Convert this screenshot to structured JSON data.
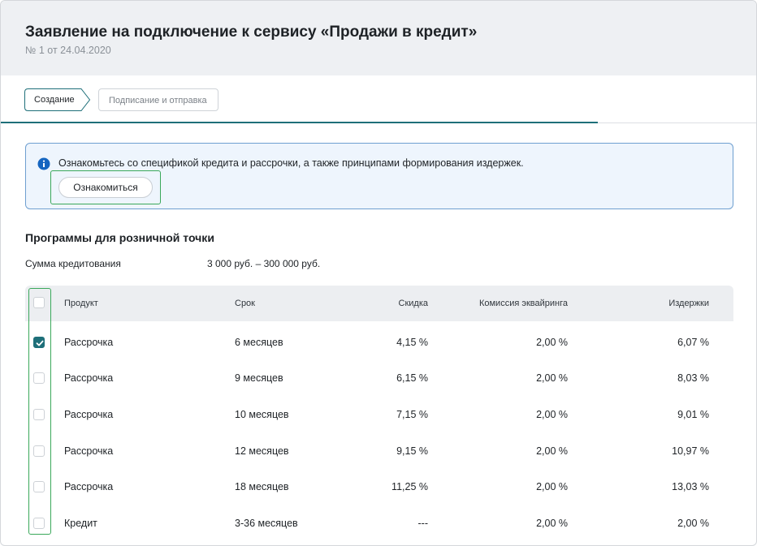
{
  "header": {
    "title": "Заявление на подключение к сервису «Продажи в кредит»",
    "subtitle": "№ 1 от 24.04.2020"
  },
  "steps": [
    {
      "label": "Создание",
      "active": true
    },
    {
      "label": "Подписание и отправка",
      "active": false
    }
  ],
  "progress": {
    "fraction": 0.79
  },
  "notice": {
    "text": "Ознакомьтесь со спецификой кредита и рассрочки, а также принципами формирования издержек.",
    "button_label": "Ознакомиться",
    "icon": "info-icon"
  },
  "programs": {
    "title": "Программы для розничной точки",
    "sum_label": "Сумма кредитования",
    "sum_value": "3 000 руб. – 300 000 руб."
  },
  "table": {
    "headers": {
      "product": "Продукт",
      "term": "Срок",
      "discount": "Скидка",
      "acquiring": "Комиссия эквайринга",
      "costs": "Издержки"
    },
    "rows": [
      {
        "checked": true,
        "product": "Рассрочка",
        "term": "6 месяцев",
        "discount": "4,15 %",
        "acquiring": "2,00 %",
        "costs": "6,07 %"
      },
      {
        "checked": false,
        "product": "Рассрочка",
        "term": "9 месяцев",
        "discount": "6,15 %",
        "acquiring": "2,00 %",
        "costs": "8,03 %"
      },
      {
        "checked": false,
        "product": "Рассрочка",
        "term": "10 месяцев",
        "discount": "7,15 %",
        "acquiring": "2,00 %",
        "costs": "9,01 %"
      },
      {
        "checked": false,
        "product": "Рассрочка",
        "term": "12 месяцев",
        "discount": "9,15 %",
        "acquiring": "2,00 %",
        "costs": "10,97 %"
      },
      {
        "checked": false,
        "product": "Рассрочка",
        "term": "18 месяцев",
        "discount": "11,25 %",
        "acquiring": "2,00 %",
        "costs": "13,03 %"
      },
      {
        "checked": false,
        "product": "Кредит",
        "term": "3-36 месяцев",
        "discount": "---",
        "acquiring": "2,00 %",
        "costs": "2,00 %"
      }
    ]
  },
  "colors": {
    "accent": "#1e6f79",
    "notice_border": "#6e9fd0",
    "notice_bg": "#eef5fd",
    "highlight": "#3aa85a"
  }
}
